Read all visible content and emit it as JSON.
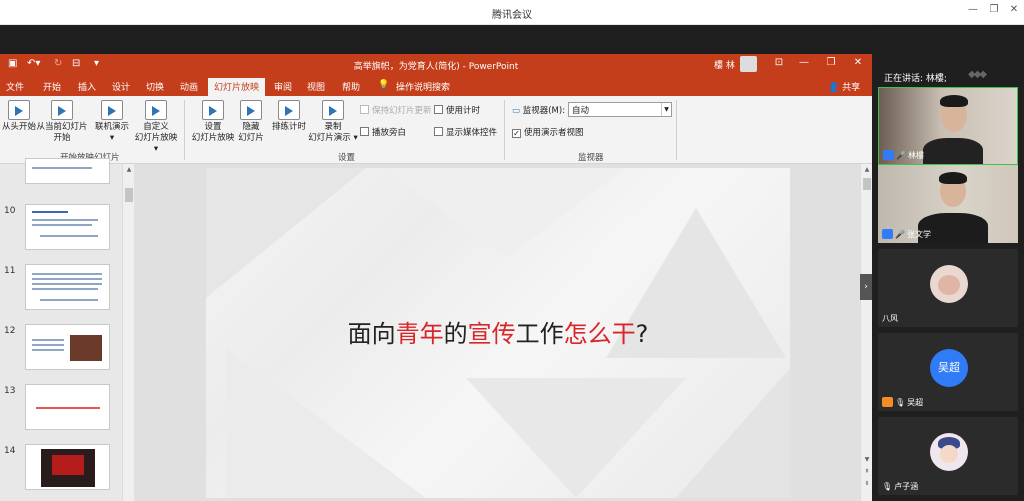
{
  "meeting": {
    "title": "腾讯会议",
    "controls": {
      "minimize": "—",
      "restore": "❐",
      "close": "✕"
    }
  },
  "ppt": {
    "title": "高举旗帜，为党育人(简化)  -  PowerPoint",
    "user_name": "樓 林",
    "window_controls": {
      "ribbon_display": "⊡",
      "minimize": "—",
      "restore": "❐",
      "close": "✕"
    },
    "tabs": [
      "文件",
      "开始",
      "插入",
      "设计",
      "切换",
      "动画",
      "幻灯片放映",
      "审阅",
      "视图",
      "帮助"
    ],
    "active_tab": "幻灯片放映",
    "tell_me": "操作说明搜索",
    "share": "共享",
    "ribbon": {
      "start_group": {
        "label": "开始放映幻灯片",
        "from_beginning": "从头开始",
        "from_current_1": "从当前幻灯片",
        "from_current_2": "开始",
        "online_1": "联机演示",
        "online_2": "▾",
        "custom_1": "自定义",
        "custom_2": "幻灯片放映 ▾"
      },
      "setup_group": {
        "label": "设置",
        "setup_1": "设置",
        "setup_2": "幻灯片放映",
        "hide_1": "隐藏",
        "hide_2": "幻灯片",
        "rehearse": "排练计时",
        "record_1": "录制",
        "record_2": "幻灯片演示 ▾",
        "keep_updated": "保持幻灯片更新",
        "play_narration": "播放旁白",
        "use_timings": "使用计时",
        "show_media": "显示媒体控件"
      },
      "monitor_group": {
        "label": "监视器",
        "monitor_label": "监视器(M):",
        "monitor_value": "自动",
        "presenter_view": "使用演示者视图"
      }
    },
    "thumbnails": [
      {
        "num": "10"
      },
      {
        "num": "11"
      },
      {
        "num": "12"
      },
      {
        "num": "13"
      },
      {
        "num": "14"
      }
    ],
    "slide": {
      "t1": "面向",
      "t2": "青年",
      "t3": "的",
      "t4": "宣传",
      "t5": "工作",
      "t6": "怎么干",
      "t7": "?"
    }
  },
  "panel": {
    "speaking": "正在讲话: 林樓;",
    "participants": [
      {
        "name": "林樓",
        "type": "video"
      },
      {
        "name": "张文学",
        "type": "video"
      },
      {
        "name": "八风",
        "type": "avatar"
      },
      {
        "name": "吴超",
        "type": "initial",
        "initial": "吴超"
      },
      {
        "name": "卢子涵",
        "type": "avatar"
      }
    ]
  },
  "colors": {
    "ppt_accent": "#c43e1c",
    "slide_red": "#d9262b",
    "active_speaker": "#3ec34e",
    "user_icon": "#2f7cf6"
  }
}
